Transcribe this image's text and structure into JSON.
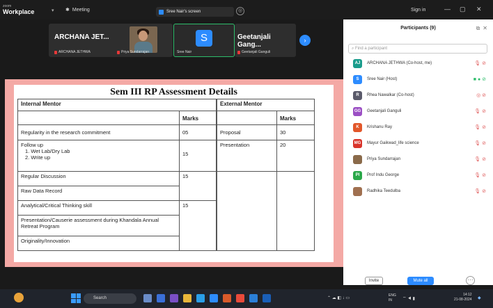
{
  "app": {
    "brand_top": "zoom",
    "brand": "Workplace",
    "meeting_label": "Meeting",
    "share_label": "Sree Nair's screen",
    "signin": "Sign in"
  },
  "window_controls": {
    "minimize": "—",
    "maximize": "▢",
    "close": "✕"
  },
  "video_strip": {
    "tiles": [
      {
        "name": "ARCHANA JET...",
        "sub": "ARCHANA JETHWA"
      },
      {
        "name": "",
        "sub": "Priya Sundarrajan"
      },
      {
        "avatar": "S",
        "sub": "Sree Nair"
      },
      {
        "name": "Geetanjali Gang...",
        "sub": "Geetanjali Ganguli"
      }
    ],
    "next_icon": "›"
  },
  "slide": {
    "title": "Sem III RP Assessment Details",
    "internal": {
      "header": "Internal Mentor",
      "marks_header": "Marks",
      "rows": [
        {
          "label": "Regularity in the research commitment",
          "marks": "05"
        },
        {
          "label": "Follow up",
          "items": [
            "1.   Wet Lab/Dry Lab",
            "2.   Write up"
          ],
          "marks": "15"
        },
        {
          "label": "Regular Discussion",
          "marks": "15"
        },
        {
          "label": "Raw Data Record",
          "marks": ""
        },
        {
          "label": "Analytical/Critical Thinking skill",
          "marks": "15"
        },
        {
          "label": "Presentation/Causerie assessment during Khandala Annual Retreat Program",
          "marks": ""
        },
        {
          "label": "Originality/Innovation",
          "marks": ""
        }
      ]
    },
    "external": {
      "header": "External Mentor",
      "marks_header": "Marks",
      "rows": [
        {
          "label": "Proposal",
          "marks": "30"
        },
        {
          "label": "Presentation",
          "marks": "20"
        }
      ]
    }
  },
  "participants": {
    "title": "Participants (9)",
    "search_placeholder": "Find a participant",
    "list": [
      {
        "initials": "AJ",
        "color": "#1a9c8c",
        "name": "ARCHANA JETHWA (Co-host, me)"
      },
      {
        "initials": "S",
        "color": "#2d8cff",
        "name": "Sree Nair (Host)"
      },
      {
        "initials": "R",
        "color": "#5a5a6a",
        "name": "Rhea Nawalkar (Co-host)"
      },
      {
        "initials": "GG",
        "color": "#9b4fc4",
        "name": "Geetanjali Ganguli"
      },
      {
        "initials": "K",
        "color": "#e2572a",
        "name": "Krishanu Ray"
      },
      {
        "initials": "MG",
        "color": "#d9342b",
        "name": "Mayur Gaikwad_life science"
      },
      {
        "initials": "",
        "color": "#8a6a4a",
        "name": "Priya Sundarrajan"
      },
      {
        "initials": "PI",
        "color": "#2ba84a",
        "name": "Prof Indu George"
      },
      {
        "initials": "",
        "color": "#a07050",
        "name": "Radhika Teedulba"
      }
    ],
    "invite": "Invite",
    "mute_all": "Mute all",
    "more": "···"
  },
  "taskbar": {
    "search": "Search",
    "lang": "ENG",
    "lang2": "IN",
    "time": "14:12",
    "date": "21-08-2024"
  }
}
